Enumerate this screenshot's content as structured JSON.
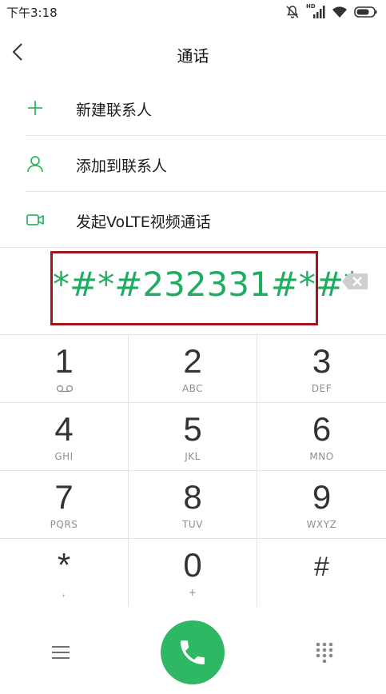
{
  "status_bar": {
    "time": "下午3:18",
    "icons": [
      "mute-icon",
      "signal-hd-icon",
      "wifi-icon",
      "battery-icon"
    ],
    "hd_label": "HD"
  },
  "header": {
    "title": "通话",
    "back_icon": "chevron-left-icon"
  },
  "menu": {
    "items": [
      {
        "label": "新建联系人",
        "icon": "plus-icon"
      },
      {
        "label": "添加到联系人",
        "icon": "person-icon"
      },
      {
        "label": "发起VoLTE视频通话",
        "icon": "video-camera-icon"
      }
    ]
  },
  "dialer": {
    "number": "*#*#232331#*#*",
    "backspace_icon": "backspace-icon"
  },
  "keypad": {
    "keys": [
      {
        "digit": "1",
        "letters": "",
        "sub_icon": "voicemail-icon"
      },
      {
        "digit": "2",
        "letters": "ABC"
      },
      {
        "digit": "3",
        "letters": "DEF"
      },
      {
        "digit": "4",
        "letters": "GHI"
      },
      {
        "digit": "5",
        "letters": "JKL"
      },
      {
        "digit": "6",
        "letters": "MNO"
      },
      {
        "digit": "7",
        "letters": "PQRS"
      },
      {
        "digit": "8",
        "letters": "TUV"
      },
      {
        "digit": "9",
        "letters": "WXYZ"
      },
      {
        "digit": "*",
        "letters": ","
      },
      {
        "digit": "0",
        "letters": "+"
      },
      {
        "digit": "#",
        "letters": ""
      }
    ]
  },
  "bottom_bar": {
    "menu_icon": "hamburger-menu-icon",
    "call_icon": "phone-icon",
    "dialpad_icon": "dialpad-icon"
  },
  "colors": {
    "accent_green": "#2fb864",
    "number_green": "#1fad62",
    "highlight_border": "#a3151b"
  }
}
